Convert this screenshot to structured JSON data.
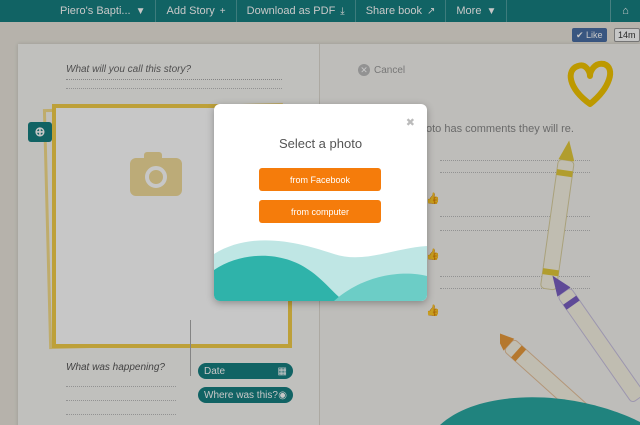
{
  "topbar": {
    "items": [
      {
        "label": "Piero's Bapti...",
        "glyph": "▼"
      },
      {
        "label": "Add Story",
        "glyph": "+"
      },
      {
        "label": "Download as PDF",
        "glyph": "⤓"
      },
      {
        "label": "Share book",
        "glyph": "↗"
      },
      {
        "label": "More",
        "glyph": "▼"
      }
    ],
    "home_icon": "⌂"
  },
  "social": {
    "like_label": "Like",
    "count": "14m"
  },
  "left_page": {
    "story_title_placeholder": "What will you call this story?",
    "happening_placeholder": "What was happening?",
    "date_label": "Date",
    "where_label": "Where was this?"
  },
  "right_page": {
    "cancel_label": "Cancel",
    "comments_text": "oto has comments they will re."
  },
  "modal": {
    "title": "Select a photo",
    "close_glyph": "✖",
    "buttons": [
      {
        "label": "from Facebook"
      },
      {
        "label": "from computer"
      }
    ]
  },
  "colors": {
    "teal": "#167f80",
    "orange": "#f57c0b",
    "yellow": "#f3ce4a"
  }
}
